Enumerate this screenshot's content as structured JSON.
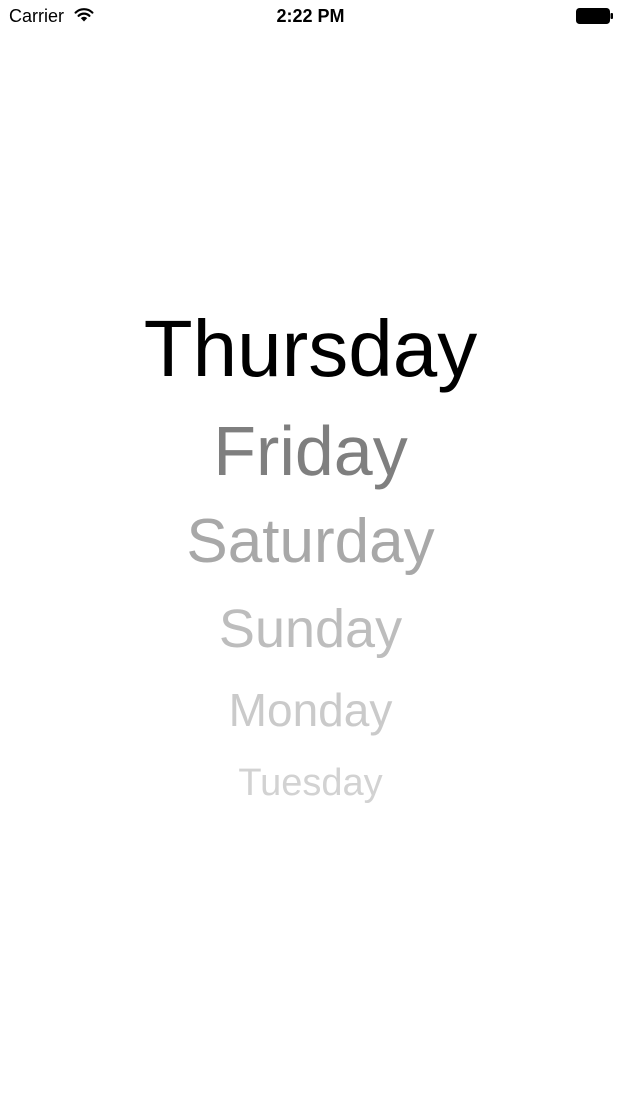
{
  "status_bar": {
    "carrier": "Carrier",
    "time": "2:22 PM",
    "icons": [
      "wifi-icon",
      "battery-icon"
    ]
  },
  "picker": {
    "days": [
      {
        "label": "Thursday",
        "color": "#000000"
      },
      {
        "label": "Friday",
        "color": "#7f7f7f"
      },
      {
        "label": "Saturday",
        "color": "#a8a8a8"
      },
      {
        "label": "Sunday",
        "color": "#bdbdbd"
      },
      {
        "label": "Monday",
        "color": "#cacaca"
      },
      {
        "label": "Tuesday",
        "color": "#d2d2d2"
      }
    ]
  }
}
